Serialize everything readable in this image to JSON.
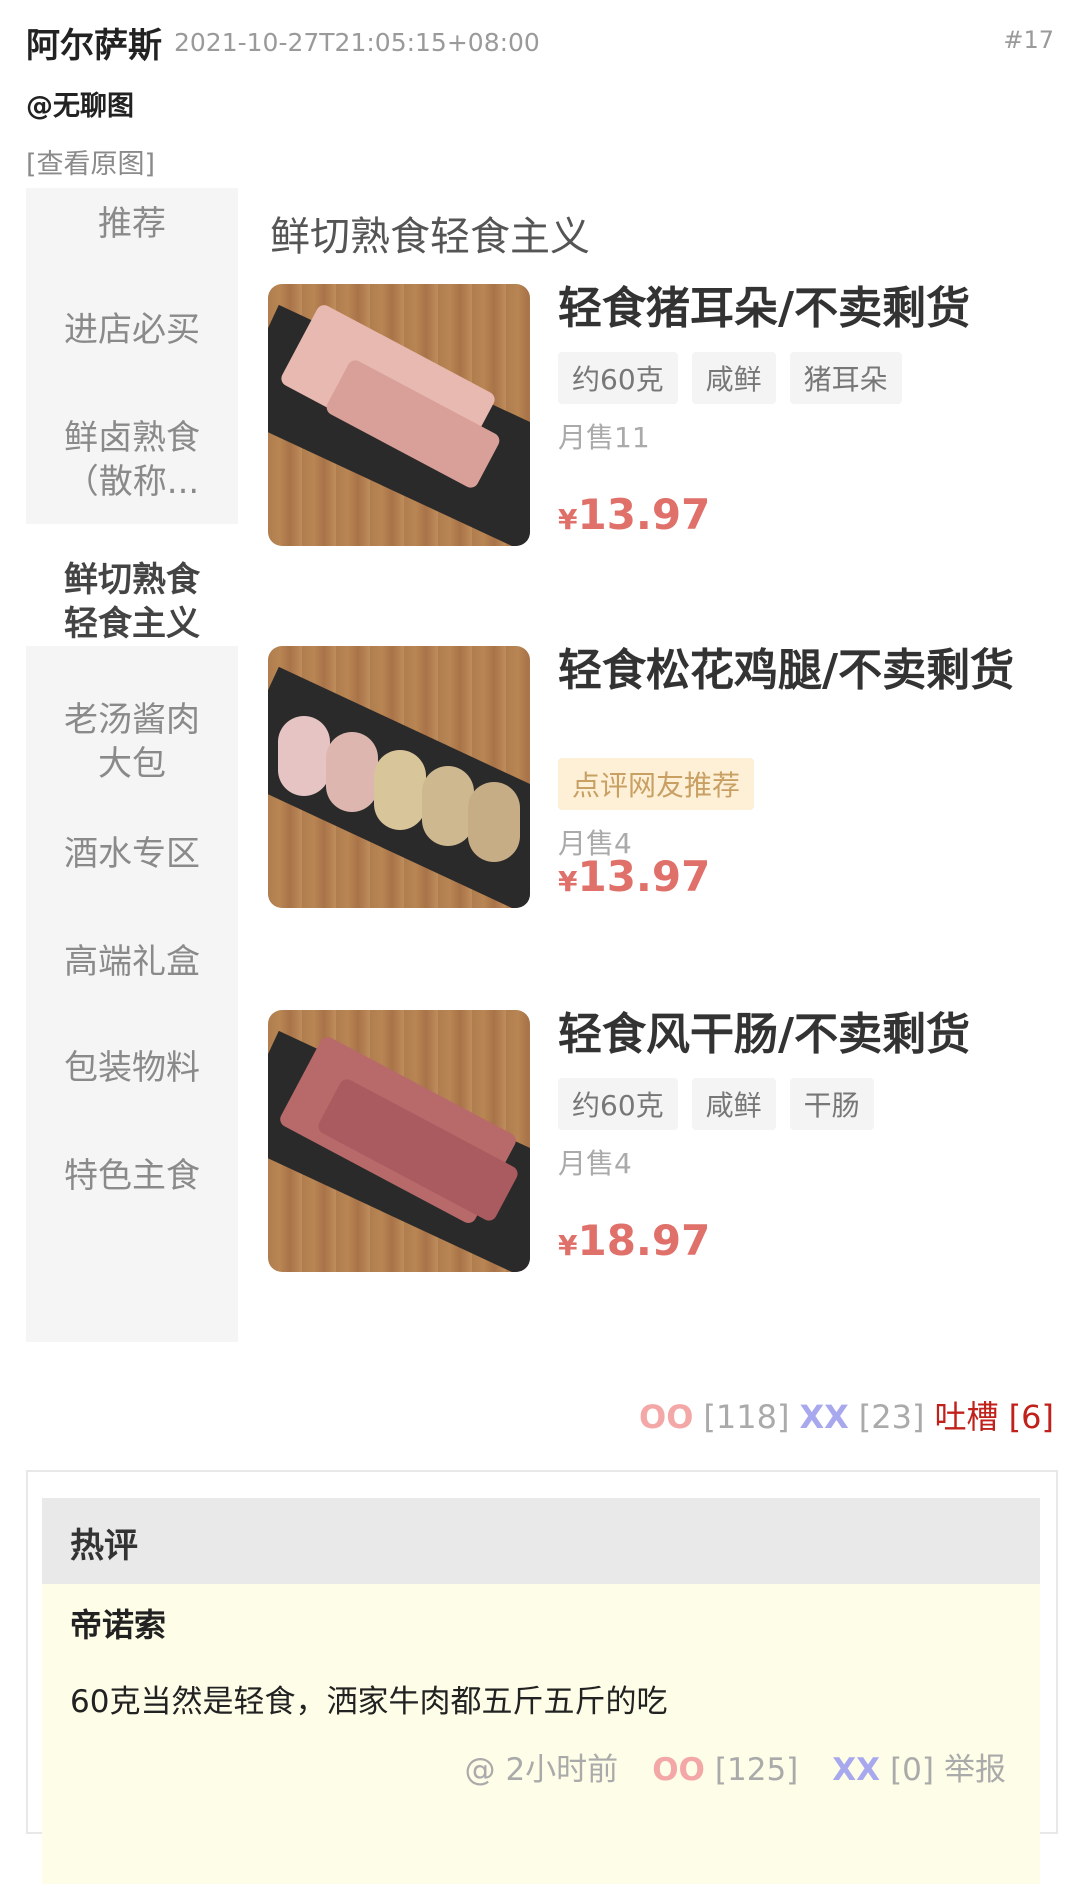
{
  "post": {
    "author": "阿尔萨斯",
    "timestamp": "2021-10-27T21:05:15+08:00",
    "number": "#17",
    "mention": "@无聊图",
    "view_original": "[查看原图]"
  },
  "screenshot": {
    "categories": [
      {
        "label": "推荐",
        "active": false
      },
      {
        "label": "进店必买",
        "active": false
      },
      {
        "label": "鲜卤熟食\n（散称...",
        "active": false
      },
      {
        "label": "鲜切熟食\n轻食主义",
        "active": true
      },
      {
        "label": "老汤酱肉\n大包",
        "active": false
      },
      {
        "label": "酒水专区",
        "active": false
      },
      {
        "label": "高端礼盒",
        "active": false
      },
      {
        "label": "包装物料",
        "active": false
      },
      {
        "label": "特色主食",
        "active": false
      }
    ],
    "section_title": "鲜切熟食轻食主义",
    "products": [
      {
        "name": "轻食猪耳朵/不卖剩货",
        "tags": [
          "约60克",
          "咸鲜",
          "猪耳朵"
        ],
        "sales": "月售11",
        "price": "13.97",
        "currency": "¥"
      },
      {
        "name": "轻食松花鸡腿/不卖剩货",
        "tags": [
          "点评网友推荐"
        ],
        "sales": "月售4",
        "price": "13.97",
        "currency": "¥"
      },
      {
        "name": "轻食风干肠/不卖剩货",
        "tags": [
          "约60克",
          "咸鲜",
          "干肠"
        ],
        "sales": "月售4",
        "price": "18.97",
        "currency": "¥"
      }
    ]
  },
  "votes": {
    "oo_label": "OO",
    "oo_count": "[118]",
    "xx_label": "XX",
    "xx_count": "[23]",
    "tucao": "吐槽 [6]"
  },
  "hot_comments": {
    "title": "热评",
    "items": [
      {
        "author": "帝诺索",
        "text": "60克当然是轻食，洒家牛肉都五斤五斤的吃",
        "at": "@",
        "time": "2小时前",
        "oo_label": "OO",
        "oo_count": "[125]",
        "xx_label": "XX",
        "xx_count": "[0]",
        "report": "举报"
      }
    ]
  },
  "colors": {
    "oo": "#f4a7a7",
    "xx": "#a8a8ee",
    "tucao": "#c0221b",
    "price": "#e0706a",
    "hot_bg": "#fdfde8"
  }
}
